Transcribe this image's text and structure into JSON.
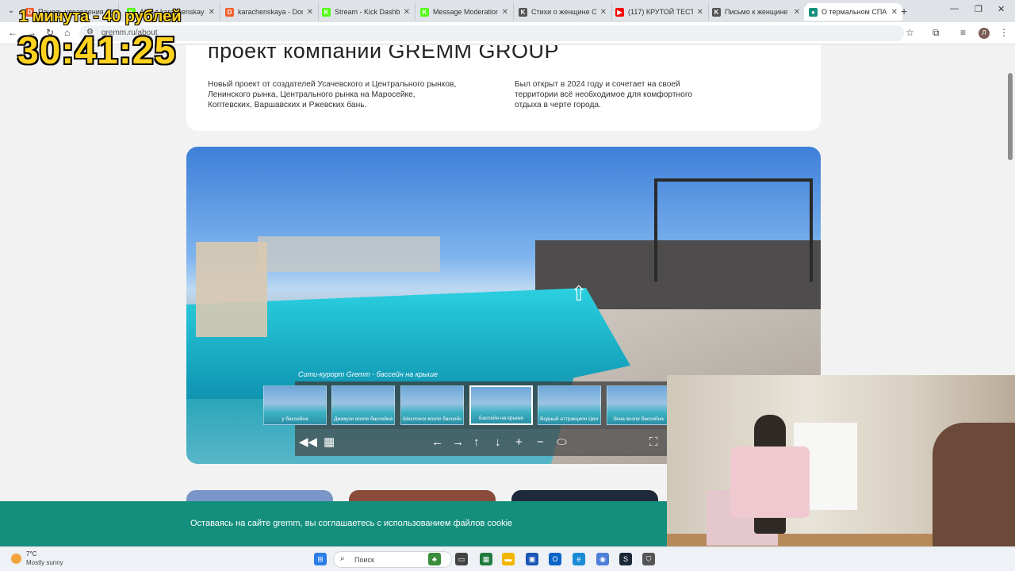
{
  "browser": {
    "tabs": [
      {
        "title": "Панель управления",
        "favicon": "boosty-icon",
        "color": "#f15f2c",
        "glyph": "D"
      },
      {
        "title": "About karachenskaya",
        "favicon": "kick-icon",
        "color": "#53fc18",
        "glyph": "K"
      },
      {
        "title": "karachenskaya - Don",
        "favicon": "boosty-icon",
        "color": "#f15f2c",
        "glyph": "D"
      },
      {
        "title": "Stream - Kick Dashbo",
        "favicon": "kick-icon",
        "color": "#53fc18",
        "glyph": "K"
      },
      {
        "title": "Message Moderation",
        "favicon": "kick-icon",
        "color": "#53fc18",
        "glyph": "K"
      },
      {
        "title": "Стихи о женщине Се",
        "favicon": "k-letter-icon",
        "color": "#555555",
        "glyph": "K"
      },
      {
        "title": "(117) КРУТОЙ ТЕСТ н",
        "favicon": "youtube-icon",
        "color": "#ff0000",
        "glyph": "▶"
      },
      {
        "title": "Письмо к женщине",
        "favicon": "k-letter-icon",
        "color": "#555555",
        "glyph": "K"
      },
      {
        "title": "О термальном СПА",
        "favicon": "gremm-icon",
        "color": "#148f7d",
        "glyph": "●"
      }
    ],
    "active_tab_index": 8,
    "url": "gremm.ru/about",
    "profile_initial": "Л"
  },
  "overlay": {
    "promo": "1 минута - 40 рублей",
    "timer": "30:41:25"
  },
  "about": {
    "title": "проект компании GREMM GROUP",
    "paragraph_left": "Новый проект от создателей Усачевского и Центрального рынков, Ленинского рынка, Центрального рынка на Маросейке, Коптевских, Варшавских и Ржевских бань.",
    "paragraph_right": "Был открыт в 2024 году и сочетает на своей территории всё необходимое для комфортного отдыха в черте города."
  },
  "panorama": {
    "caption": "Сити-курорт Gremm - бассейн на крыше",
    "thumbnails": [
      {
        "label": "у бассейна"
      },
      {
        "label": "Джакузи возле бассейна"
      },
      {
        "label": "Шезлонги возле бассейна"
      },
      {
        "label": "Бассейн на крыше"
      },
      {
        "label": "Водный аттракцион Центрифуга"
      },
      {
        "label": "Зона возле бассейна"
      }
    ],
    "active_thumbnail_index": 3
  },
  "cookie": {
    "text": "Оставаясь на сайте gremm, вы соглашаетесь с использованием файлов cookie"
  },
  "taskbar": {
    "weather_temp": "7°C",
    "weather_desc": "Mostly sunny",
    "search_placeholder": "Поиск"
  },
  "colors": {
    "brand": "#148f7d",
    "overlay_yellow": "#ffd21f"
  }
}
